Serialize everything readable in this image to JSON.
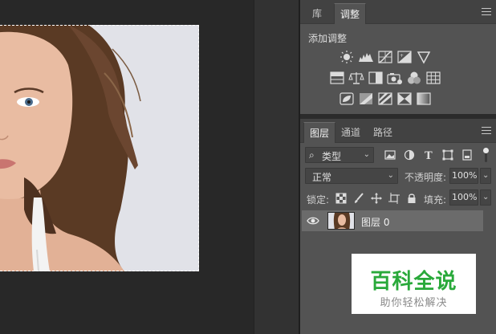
{
  "adjustments_panel": {
    "tabs": [
      {
        "label": "库",
        "active": false
      },
      {
        "label": "调整",
        "active": true
      }
    ],
    "title": "添加调整",
    "rows": [
      [
        "brightness-contrast-icon",
        "levels-icon",
        "curves-icon",
        "exposure-icon",
        "vibrance-icon"
      ],
      [
        "hue-saturation-icon",
        "color-balance-icon",
        "black-white-icon",
        "photo-filter-icon",
        "channel-mixer-icon",
        "color-lookup-icon"
      ],
      [
        "invert-icon",
        "posterize-icon",
        "threshold-icon",
        "selective-color-icon",
        "gradient-map-icon"
      ]
    ]
  },
  "layers_panel": {
    "tabs": [
      {
        "label": "图层",
        "active": true
      },
      {
        "label": "通道",
        "active": false
      },
      {
        "label": "路径",
        "active": false
      }
    ],
    "filter": {
      "label": "类型",
      "icon": "search-icon"
    },
    "filter_icons": [
      "image-filter-icon",
      "adjustment-filter-icon",
      "type-filter-icon",
      "shape-filter-icon",
      "smart-object-filter-icon"
    ],
    "blend_mode": "正常",
    "opacity_label": "不透明度:",
    "opacity_value": "100%",
    "lock_label": "锁定:",
    "lock_icons": [
      "lock-transparent-icon",
      "lock-paint-icon",
      "lock-position-icon",
      "lock-artboard-icon",
      "lock-all-icon"
    ],
    "fill_label": "填充:",
    "fill_value": "100%",
    "layer": {
      "name": "图层 0",
      "visible": true
    }
  },
  "watermark": {
    "title": "百科全说",
    "subtitle": "助你轻松解决"
  },
  "colors": {
    "accent_green": "#29a93a",
    "panel_bg": "#535353",
    "canvas_bg": "#282828"
  }
}
